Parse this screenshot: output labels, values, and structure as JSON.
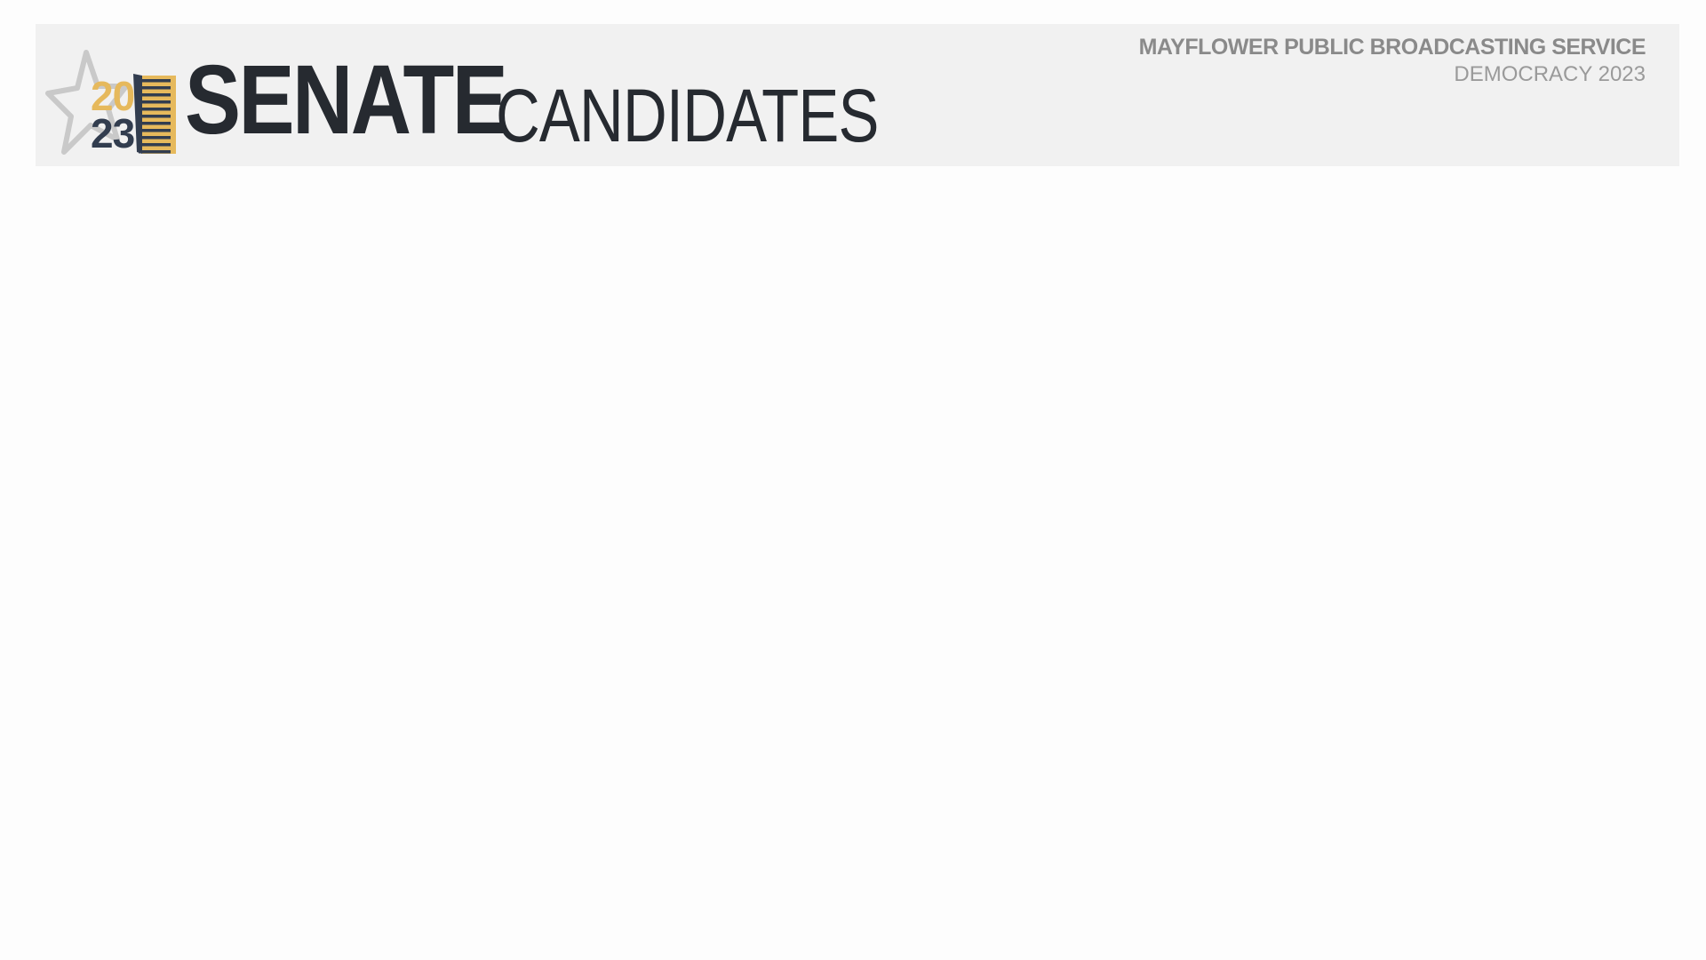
{
  "header": {
    "logo": {
      "year_top": "20",
      "year_bottom": "23",
      "icon": "star-ballot-logo"
    },
    "title_main": "SENATE",
    "title_sub": "CANDIDATES",
    "org_name": "MAYFLOWER PUBLIC BROADCASTING SERVICE",
    "org_subtitle": "DEMOCRACY 2023"
  },
  "colors": {
    "page_background": "#fdfdfd",
    "banner_background": "#f1f1f1",
    "title_text": "#262a30",
    "org_text": "#8a8a8a",
    "org_subtitle_text": "#9a9a9a",
    "logo_gold": "#e6b95c",
    "logo_navy": "#323d4f",
    "logo_star": "#c9c9c9"
  }
}
